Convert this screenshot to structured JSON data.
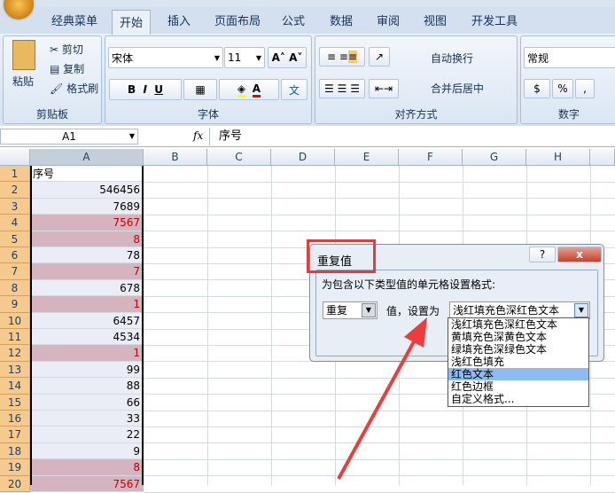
{
  "tabs": [
    "经典菜单",
    "开始",
    "插入",
    "页面布局",
    "公式",
    "数据",
    "审阅",
    "视图",
    "开发工具"
  ],
  "clipboard": {
    "paste": "粘贴",
    "cut": "剪切",
    "copy": "复制",
    "format_painter": "格式刷",
    "label": "剪贴板"
  },
  "font": {
    "name": "宋体",
    "size": "11",
    "bold": "B",
    "italic": "I",
    "underline": "U",
    "label": "字体",
    "font_color": "A",
    "phonetic": "文"
  },
  "alignment": {
    "wrap": "自动换行",
    "merge": "合并后居中",
    "label": "对齐方式"
  },
  "number": {
    "format": "常规",
    "percent": "%",
    "comma": ",",
    "label": "数字"
  },
  "formula_bar": {
    "name_box": "A1",
    "fx": "fx",
    "value": "序号"
  },
  "columns": [
    "A",
    "B",
    "C",
    "D",
    "E",
    "F",
    "G",
    "H"
  ],
  "rows": [
    {
      "n": "1",
      "v": "序号",
      "dup": false
    },
    {
      "n": "2",
      "v": "546456",
      "dup": false
    },
    {
      "n": "3",
      "v": "7689",
      "dup": false
    },
    {
      "n": "4",
      "v": "7567",
      "dup": true
    },
    {
      "n": "5",
      "v": "8",
      "dup": true
    },
    {
      "n": "6",
      "v": "78",
      "dup": false
    },
    {
      "n": "7",
      "v": "7",
      "dup": true
    },
    {
      "n": "8",
      "v": "678",
      "dup": false
    },
    {
      "n": "9",
      "v": "1",
      "dup": true
    },
    {
      "n": "10",
      "v": "6457",
      "dup": false
    },
    {
      "n": "11",
      "v": "4534",
      "dup": false
    },
    {
      "n": "12",
      "v": "1",
      "dup": true
    },
    {
      "n": "13",
      "v": "99",
      "dup": false
    },
    {
      "n": "14",
      "v": "88",
      "dup": false
    },
    {
      "n": "15",
      "v": "66",
      "dup": false
    },
    {
      "n": "16",
      "v": "33",
      "dup": false
    },
    {
      "n": "17",
      "v": "22",
      "dup": false
    },
    {
      "n": "18",
      "v": "9",
      "dup": false
    },
    {
      "n": "19",
      "v": "8",
      "dup": true
    },
    {
      "n": "20",
      "v": "7567",
      "dup": true
    }
  ],
  "dialog": {
    "title": "重复值",
    "help": "?",
    "close": "x",
    "prompt": "为包含以下类型值的单元格设置格式:",
    "type_value": "重复",
    "middle": "值，设置为",
    "format_value": "浅红填充色深红色文本",
    "options": [
      "浅红填充色深红色文本",
      "黄填充色深黄色文本",
      "绿填充色深绿色文本",
      "浅红色填充",
      "红色文本",
      "红色边框",
      "自定义格式..."
    ],
    "selected_index": 4
  }
}
